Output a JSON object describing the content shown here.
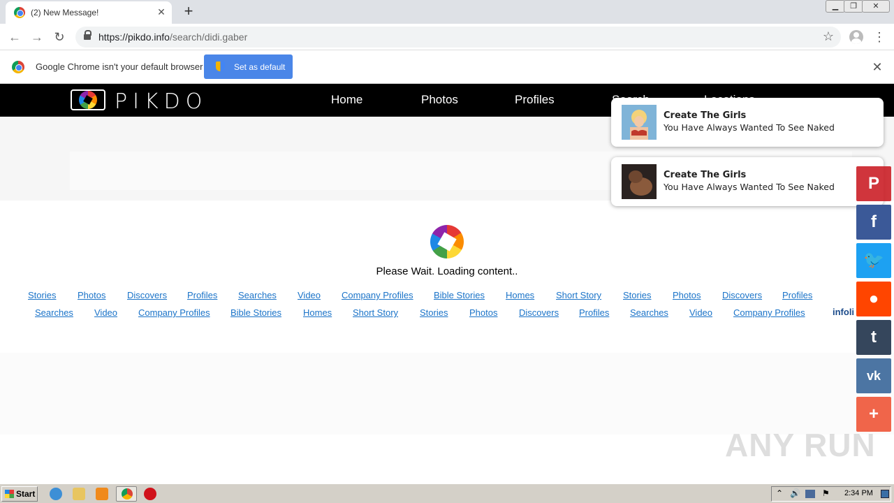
{
  "browser": {
    "tab_title": "(2) New Message!",
    "url_host": "https://pikdo.info",
    "url_path": "/search/didi.gaber"
  },
  "infobar": {
    "message": "Google Chrome isn't your default browser",
    "button": "Set as default"
  },
  "site": {
    "logo": "PIKDO",
    "nav": [
      "Home",
      "Photos",
      "Profiles",
      "Search",
      "Locations"
    ],
    "loading": "Please Wait. Loading content..",
    "links_row1": [
      "Stories",
      "Photos",
      "Discovers",
      "Profiles",
      "Searches",
      "Video",
      "Company Profiles",
      "Bible Stories",
      "Homes",
      "Short Story",
      "Stories",
      "Photos",
      "Discovers",
      "Profiles"
    ],
    "links_row2": [
      "Searches",
      "Video",
      "Company Profiles",
      "Bible Stories",
      "Homes",
      "Short Story",
      "Stories",
      "Photos",
      "Discovers",
      "Profiles",
      "Searches",
      "Video",
      "Company Profiles"
    ],
    "infolinks": "infoli"
  },
  "notifications": [
    {
      "title": "Create The Girls",
      "body": "You Have Always Wanted To See Naked"
    },
    {
      "title": "Create The Girls",
      "body": "You Have Always Wanted To See Naked"
    }
  ],
  "share": [
    {
      "name": "pinterest",
      "glyph": "P",
      "color": "#cb2027"
    },
    {
      "name": "facebook",
      "glyph": "f",
      "color": "#3b5998"
    },
    {
      "name": "twitter",
      "glyph": "🐦",
      "color": "#1da1f2"
    },
    {
      "name": "reddit",
      "glyph": "●",
      "color": "#ff4500"
    },
    {
      "name": "tumblr",
      "glyph": "t",
      "color": "#35465c"
    },
    {
      "name": "vk",
      "glyph": "vk",
      "color": "#4c75a3"
    },
    {
      "name": "more",
      "glyph": "+",
      "color": "#f0654a"
    }
  ],
  "watermark": "ANY RUN",
  "taskbar": {
    "start": "Start",
    "clock": "2:34 PM"
  }
}
